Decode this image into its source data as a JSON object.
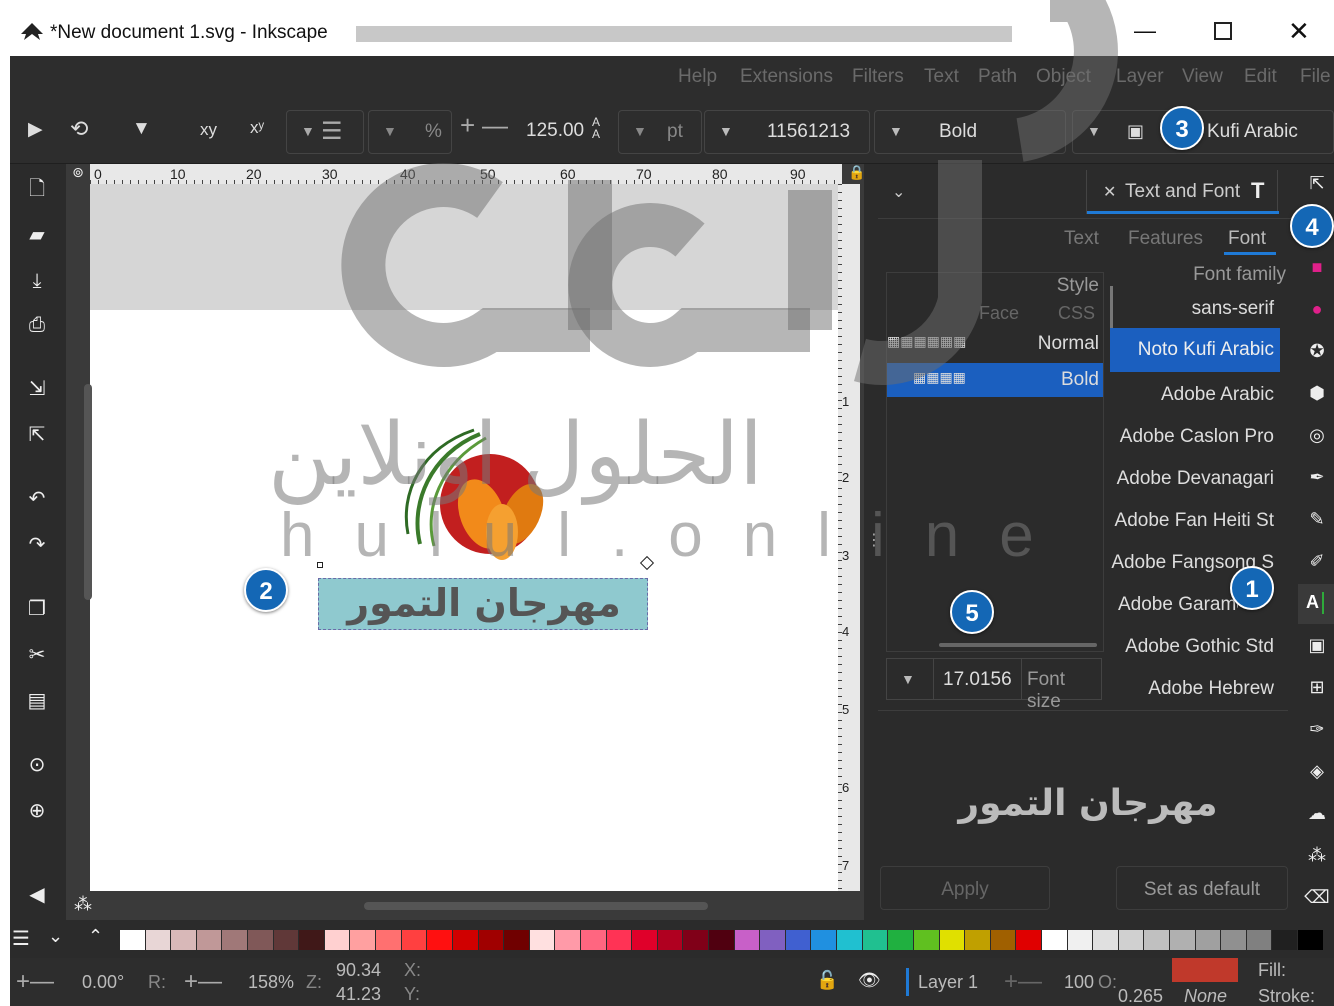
{
  "window": {
    "title": "*New document 1.svg - Inkscape"
  },
  "menu": [
    "Help",
    "Extensions",
    "Filters",
    "Text",
    "Path",
    "Object",
    "Layer",
    "View",
    "Edit",
    "File"
  ],
  "toolbar": {
    "sub_label": "xy",
    "sup_label": "xʸ",
    "percent": "%",
    "line_spacing": "125.00",
    "unit": "pt",
    "font_size_partial": "11561213",
    "style": "Bold",
    "font_family": "Kufi Arabic"
  },
  "ruler": {
    "h": [
      "0",
      "10",
      "20",
      "30",
      "40",
      "50",
      "60",
      "70",
      "80",
      "90"
    ],
    "v": [
      "1",
      "2",
      "3",
      "4",
      "5",
      "6",
      "7"
    ]
  },
  "canvas": {
    "text": "مهرجان التمور"
  },
  "panel": {
    "tab_title": "Text and Font",
    "tabs": [
      "Text",
      "Features",
      "Font"
    ],
    "style_header": "Style",
    "family_header": "Font family",
    "face_header": "Face",
    "css_header": "CSS",
    "styles": [
      {
        "css": "Normal"
      },
      {
        "css": "Bold"
      }
    ],
    "families": [
      "sans-serif",
      "Noto Kufi Arabic",
      "Adobe Arabic",
      "Adobe Caslon Pro",
      "Adobe Devanagari",
      "Adobe Fan Heiti St",
      "Adobe Fangsong S",
      "Adobe Garamond",
      "Adobe Gothic Std",
      "Adobe Hebrew"
    ],
    "font_size_value": "17.0156",
    "font_size_label": "Font size",
    "preview": "مهرجان التمور",
    "apply": "Apply",
    "set_default": "Set as default"
  },
  "status": {
    "rotation": "0.00°",
    "r_label": "R:",
    "zoom": "158%",
    "z_label": "Z:",
    "x_coord": "90.34",
    "y_coord": "41.23",
    "x_label": "X:",
    "y_label": "Y:",
    "layer": "Layer 1",
    "opacity": "100",
    "o_label": "O:",
    "stroke_width": "0.265",
    "stroke_value": "None",
    "fill_label": "Fill:",
    "stroke_label": "Stroke:"
  },
  "callouts": [
    "1",
    "2",
    "3",
    "4",
    "5"
  ],
  "watermark": {
    "arabic": "الحلول اونلاين",
    "latin": "hulul.online"
  },
  "colors": {
    "accent": "#1467b5",
    "selected": "#1b5fbf",
    "fill_swatch": "#c0392b",
    "text_bg": "#8fc9cf"
  },
  "palette": [
    "#ffffff",
    "#e8d6d6",
    "#d8b8b8",
    "#c09898",
    "#a07878",
    "#805858",
    "#603838",
    "#401818",
    "#ffd0d0",
    "#ffa0a0",
    "#ff7070",
    "#ff4040",
    "#ff1010",
    "#d00000",
    "#a00000",
    "#700000",
    "#ffe0e0",
    "#ff9aa8",
    "#ff6680",
    "#ff3355",
    "#e0002a",
    "#b00020",
    "#800018",
    "#500010",
    "#c860c8",
    "#8060c0",
    "#4060d0",
    "#2090e0",
    "#20c0d0",
    "#20c090",
    "#20b040",
    "#60c020",
    "#e0e000",
    "#c0a000",
    "#a06000",
    "#e00000",
    "#ffffff",
    "#f0f0f0",
    "#e0e0e0",
    "#d0d0d0",
    "#c0c0c0",
    "#b0b0b0",
    "#a0a0a0",
    "#909090",
    "#808080",
    "#202020",
    "#000000"
  ]
}
